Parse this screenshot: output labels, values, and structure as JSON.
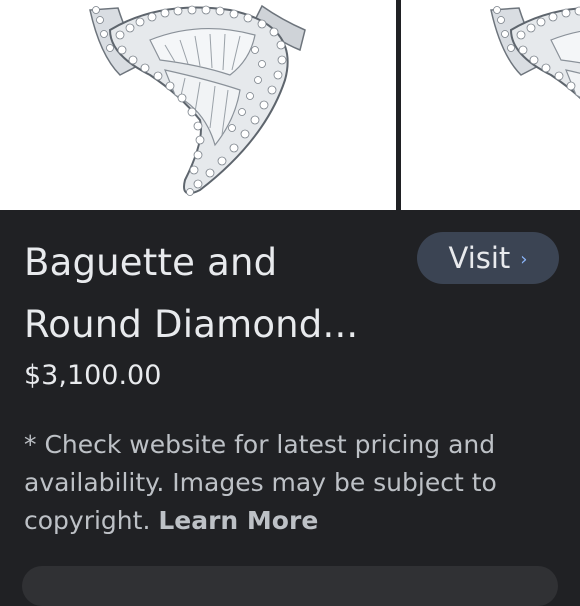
{
  "gallery": {
    "images": [
      {
        "subject": "diamond-ring-image"
      },
      {
        "subject": "diamond-ring-image"
      }
    ]
  },
  "product": {
    "title": "Baguette and Round Diamond...",
    "price": "$3,100.00"
  },
  "visit_button": {
    "label": "Visit",
    "icon": "chevron-right-icon",
    "chevron": "›"
  },
  "disclaimer": {
    "text": "* Check website for latest pricing and availability. Images may be subject to copyright. ",
    "link_label": "Learn More"
  },
  "colors": {
    "background": "#202124",
    "button": "#3b4453",
    "accent": "#8ab4f8",
    "text": "#e8eaed",
    "secondary_text": "#bdc1c6"
  }
}
